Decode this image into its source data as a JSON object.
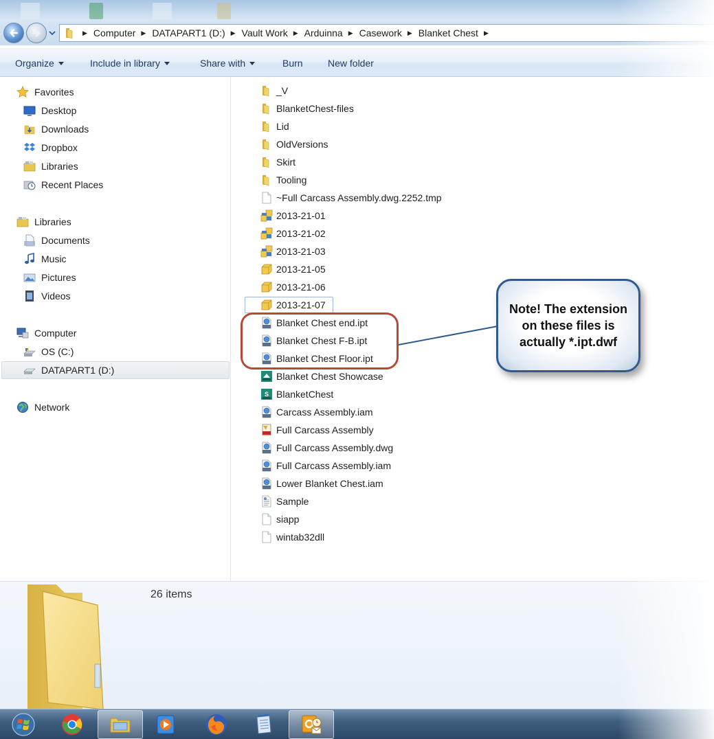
{
  "address": {
    "crumbs": [
      "Computer",
      "DATAPART1 (D:)",
      "Vault Work",
      "Arduinna",
      "Casework",
      "Blanket Chest"
    ]
  },
  "toolbar": {
    "organize": "Organize",
    "include_in_library": "Include in library",
    "share_with": "Share with",
    "burn": "Burn",
    "new_folder": "New folder"
  },
  "nav": {
    "favorites": "Favorites",
    "desktop": "Desktop",
    "downloads": "Downloads",
    "dropbox": "Dropbox",
    "libraries_fav": "Libraries",
    "recent_places": "Recent Places",
    "libraries": "Libraries",
    "documents": "Documents",
    "music": "Music",
    "pictures": "Pictures",
    "videos": "Videos",
    "computer": "Computer",
    "os_c": "OS (C:)",
    "datapart1": "DATAPART1 (D:)",
    "network": "Network"
  },
  "files": [
    {
      "name": "_V",
      "icon": "folder-icon"
    },
    {
      "name": "BlanketChest-files",
      "icon": "folder-icon"
    },
    {
      "name": "Lid",
      "icon": "folder-icon"
    },
    {
      "name": "OldVersions",
      "icon": "folder-icon"
    },
    {
      "name": "Skirt",
      "icon": "folder-icon"
    },
    {
      "name": "Tooling",
      "icon": "folder-icon"
    },
    {
      "name": "~Full Carcass Assembly.dwg.2252.tmp",
      "icon": "blank-file-icon"
    },
    {
      "name": "2013-21-01",
      "icon": "assembly-icon"
    },
    {
      "name": "2013-21-02",
      "icon": "assembly-icon"
    },
    {
      "name": "2013-21-03",
      "icon": "assembly-icon"
    },
    {
      "name": "2013-21-05",
      "icon": "part-icon"
    },
    {
      "name": "2013-21-06",
      "icon": "part-icon"
    },
    {
      "name": "2013-21-07",
      "icon": "part-icon"
    },
    {
      "name": "Blanket Chest end.ipt",
      "icon": "dwf-file-icon"
    },
    {
      "name": "Blanket Chest F-B.ipt",
      "icon": "dwf-file-icon"
    },
    {
      "name": "Blanket Chest Floor.ipt",
      "icon": "dwf-file-icon"
    },
    {
      "name": "Blanket Chest Showcase",
      "icon": "showcase-file-icon"
    },
    {
      "name": "BlanketChest",
      "icon": "inventor-file-icon"
    },
    {
      "name": "Carcass Assembly.iam",
      "icon": "dwf-file-icon"
    },
    {
      "name": "Full Carcass Assembly",
      "icon": "dwg-file-icon"
    },
    {
      "name": "Full Carcass Assembly.dwg",
      "icon": "dwf-file-icon"
    },
    {
      "name": "Full Carcass Assembly.iam",
      "icon": "dwf-file-icon"
    },
    {
      "name": "Lower Blanket Chest.iam",
      "icon": "dwf-file-icon"
    },
    {
      "name": "Sample",
      "icon": "text-file-icon"
    },
    {
      "name": "siapp",
      "icon": "blank-file-icon"
    },
    {
      "name": "wintab32dll",
      "icon": "blank-file-icon"
    }
  ],
  "details": {
    "item_count": "26 items"
  },
  "callout": {
    "text": "Note!  The extension on these files is actually *.ipt.dwf"
  },
  "colors": {
    "callout_ring": "#b74a35",
    "callout_border": "#2f5a8e",
    "folder": "#e8c64f",
    "toolbar_text": "#1e3a5f"
  }
}
